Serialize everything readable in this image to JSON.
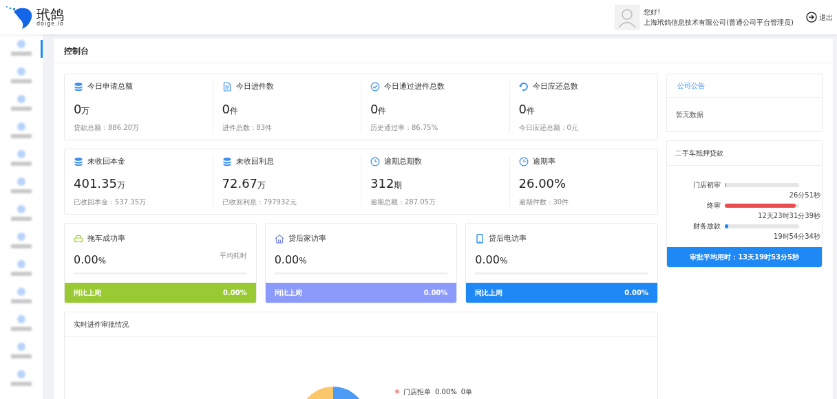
{
  "header": {
    "logo_text": "玳鸽",
    "logo_subtext": "doige.io",
    "greeting": "您好!",
    "user": "上海玳鸽信息技术有限公司(普通公司平台管理员)",
    "logout": "退出"
  },
  "sidebar": {
    "items": [
      {
        "selected": true
      },
      {
        "selected": false
      },
      {
        "selected": false
      },
      {
        "selected": false
      },
      {
        "selected": false
      },
      {
        "selected": false
      },
      {
        "selected": false
      },
      {
        "selected": false
      },
      {
        "selected": false
      },
      {
        "selected": false
      },
      {
        "selected": false
      },
      {
        "selected": false
      },
      {
        "selected": false
      }
    ]
  },
  "page_title": "控制台",
  "summary_rows": [
    [
      {
        "kind": "coins",
        "title": "今日申请总额",
        "value": "0",
        "unit": "万",
        "note": "贷款总额：886.20万"
      },
      {
        "kind": "document",
        "title": "今日进件数",
        "value": "0",
        "unit": "件",
        "note": "进件总数：83件"
      },
      {
        "kind": "check",
        "title": "今日通过进件总数",
        "value": "0",
        "unit": "件",
        "note": "历史通过率：86.75%"
      },
      {
        "kind": "refresh",
        "title": "今日应还总数",
        "value": "0",
        "unit": "件",
        "note": "今日应还总额：0元"
      }
    ],
    [
      {
        "kind": "coins",
        "title": "未收回本金",
        "value": "401.35",
        "unit": "万",
        "note": "已收回本金：537.35万"
      },
      {
        "kind": "coins",
        "title": "未收回利息",
        "value": "72.67",
        "unit": "万",
        "note": "已收回利息：797932元"
      },
      {
        "kind": "clock",
        "title": "逾期总期数",
        "value": "312",
        "unit": "期",
        "note": "逾期总额：287.05万"
      },
      {
        "kind": "clock",
        "title": "逾期率",
        "value": "26.00%",
        "note": "逾期件数：30件"
      }
    ]
  ],
  "rate_cards": [
    {
      "kind": "car",
      "title": "拖车成功率",
      "value": "0.00",
      "unit": "%",
      "aside": "平均耗时",
      "footer_label": "同比上周",
      "footer_value": "0.00%",
      "color": "#9aca33"
    },
    {
      "kind": "house",
      "title": "贷后家访率",
      "value": "0.00",
      "unit": "%",
      "footer_label": "同比上周",
      "footer_value": "0.00%",
      "color": "#8c9bfb"
    },
    {
      "kind": "phone",
      "title": "贷后电访率",
      "value": "0.00",
      "unit": "%",
      "footer_label": "同比上周",
      "footer_value": "0.00%",
      "color": "#1e88f5"
    }
  ],
  "approval_panel": {
    "title": "实时进件审批情况",
    "legend": [
      {
        "label": "门店拒单",
        "percent": "0.00%",
        "count": "0单",
        "color": "#f29b9b"
      }
    ]
  },
  "notice": {
    "title": "公司公告",
    "empty": "暂无数据"
  },
  "loan": {
    "title": "二手车抵押贷款",
    "stages": [
      {
        "label": "门店初审",
        "level": 0.01,
        "time": "26分51秒",
        "color": "#9aca33"
      },
      {
        "label": "终审",
        "level": 0.95,
        "time": "12天23时31分39秒",
        "color": "#ea4d4d"
      },
      {
        "label": "财务放款",
        "level": 0.05,
        "time": "19时54分34秒",
        "color": "#1e88f5"
      }
    ],
    "footer": "审批平均用时：13天19时53分5秒"
  }
}
